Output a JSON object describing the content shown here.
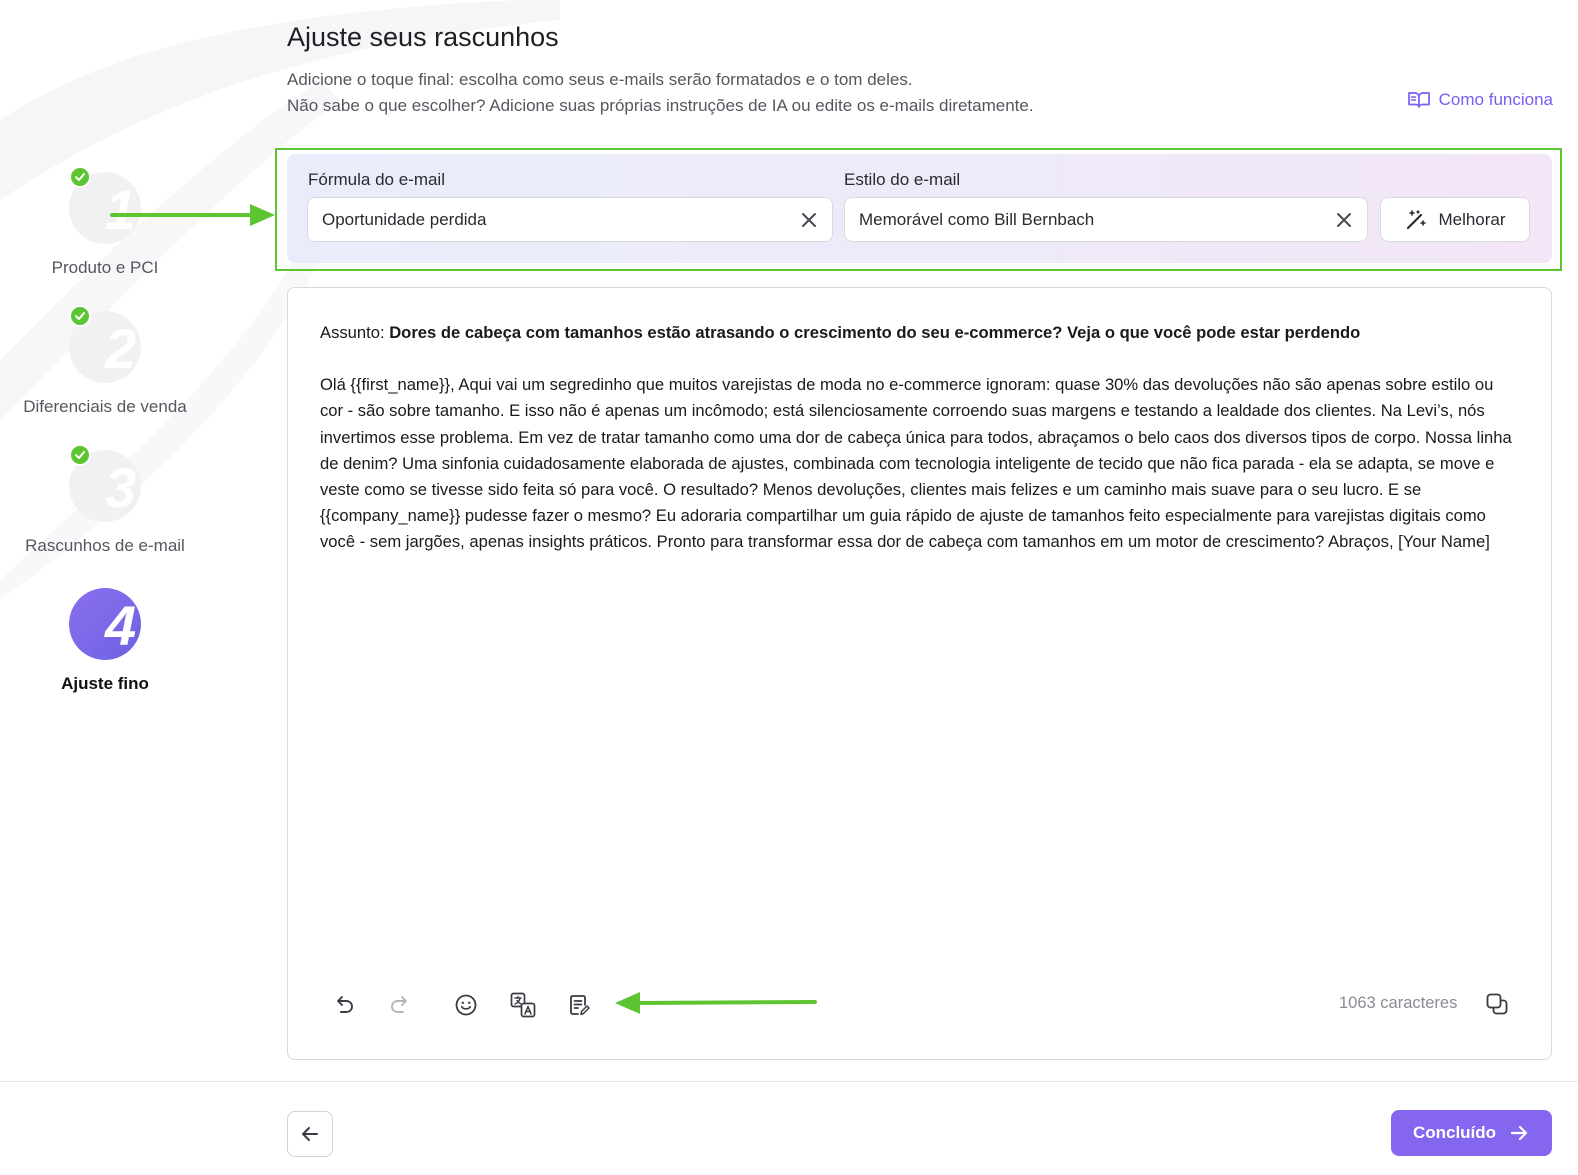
{
  "header": {
    "title": "Ajuste seus rascunhos",
    "subtitle_line1": "Adicione o toque final: escolha como seus e-mails serão formatados e o tom deles.",
    "subtitle_line2": "Não sabe o que escolher? Adicione suas próprias instruções de IA ou edite os e-mails diretamente.",
    "how_link": "Como funciona"
  },
  "steps": [
    {
      "number": "1",
      "label": "Produto e PCI",
      "status": "done"
    },
    {
      "number": "2",
      "label": "Diferenciais de venda",
      "status": "done"
    },
    {
      "number": "3",
      "label": "Rascunhos de e-mail",
      "status": "done"
    },
    {
      "number": "4",
      "label": "Ajuste fino",
      "status": "active"
    }
  ],
  "filters": {
    "formula_label": "Fórmula do e-mail",
    "formula_value": "Oportunidade perdida",
    "style_label": "Estilo do e-mail",
    "style_value": "Memorável como Bill Bernbach",
    "improve_button": "Melhorar"
  },
  "email": {
    "subject_label": "Assunto:",
    "subject": "Dores de cabeça com tamanhos estão atrasando o crescimento do seu e-commerce? Veja o que você pode estar perdendo",
    "body": "Olá {{first_name}}, Aqui vai um segredinho que muitos varejistas de moda no e-commerce ignoram: quase 30% das devoluções não são apenas sobre estilo ou cor - são sobre tamanho. E isso não é apenas um incômodo; está silenciosamente corroendo suas margens e testando a lealdade dos clientes. Na Levi’s, nós invertimos esse problema. Em vez de tratar tamanho como uma dor de cabeça única para todos, abraçamos o belo caos dos diversos tipos de corpo. Nossa linha de denim? Uma sinfonia cuidadosamente elaborada de ajustes, combinada com tecnologia inteligente de tecido que não fica parada - ela se adapta, se move e veste como se tivesse sido feita só para você. O resultado? Menos devoluções, clientes mais felizes e um caminho mais suave para o seu lucro. E se {{company_name}} pudesse fazer o mesmo? Eu adoraria compartilhar um guia rápido de ajuste de tamanhos feito especialmente para varejistas digitais como você - sem jargões, apenas insights práticos. Pronto para transformar essa dor de cabeça com tamanhos em um motor de crescimento? Abraços, [Your Name]",
    "char_count": "1063 caracteres"
  },
  "toolbar": {
    "icons": [
      "undo-icon",
      "redo-icon",
      "emoji-icon",
      "translate-icon",
      "notes-icon",
      "copy-icon"
    ]
  },
  "footer": {
    "done_button": "Concluído"
  },
  "colors": {
    "accent": "#8466ef",
    "success": "#5cc531",
    "annotation": "#5cc531"
  }
}
